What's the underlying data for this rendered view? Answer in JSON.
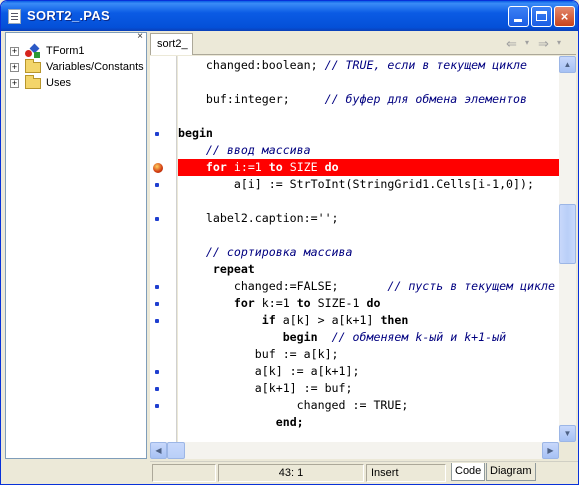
{
  "window": {
    "title": "SORT2_.PAS",
    "close_glyph": "×"
  },
  "tree": {
    "close_glyph": "×",
    "items": [
      {
        "label": "TForm1",
        "icon": "form-components-icon",
        "expander": "+"
      },
      {
        "label": "Variables/Constants",
        "icon": "folder-icon",
        "expander": "+"
      },
      {
        "label": "Uses",
        "icon": "folder-icon",
        "expander": "+"
      }
    ]
  },
  "editor": {
    "tab_label": "sort2_",
    "nav_back": "⇐",
    "nav_forward": "⇒",
    "nav_dropdown": "▾",
    "lines": [
      {
        "segments": [
          {
            "t": "    changed:boolean; "
          },
          {
            "t": "// TRUE, если в текущем цикле",
            "c": "cm"
          }
        ],
        "marker": ""
      },
      {
        "segments": [
          {
            "t": ""
          }
        ],
        "marker": ""
      },
      {
        "segments": [
          {
            "t": "    buf:integer;     "
          },
          {
            "t": "// буфер для обмена элементов",
            "c": "cm"
          }
        ],
        "marker": ""
      },
      {
        "segments": [
          {
            "t": ""
          }
        ],
        "marker": ""
      },
      {
        "segments": [
          {
            "t": "begin",
            "c": "kw"
          }
        ],
        "marker": "dot"
      },
      {
        "segments": [
          {
            "t": "    "
          },
          {
            "t": "// ввод массива",
            "c": "cm"
          }
        ],
        "marker": ""
      },
      {
        "segments": [
          {
            "t": "    "
          },
          {
            "t": "for",
            "c": "kw"
          },
          {
            "t": " i:=1 "
          },
          {
            "t": "to",
            "c": "kw"
          },
          {
            "t": " SIZE "
          },
          {
            "t": "do",
            "c": "kw"
          }
        ],
        "marker": "breakpoint",
        "highlight": true
      },
      {
        "segments": [
          {
            "t": "        a[i] := StrToInt(StringGrid1.Cells[i-1,0]);"
          }
        ],
        "marker": "dot"
      },
      {
        "segments": [
          {
            "t": ""
          }
        ],
        "marker": ""
      },
      {
        "segments": [
          {
            "t": "    label2.caption:='';"
          }
        ],
        "marker": "dot"
      },
      {
        "segments": [
          {
            "t": ""
          }
        ],
        "marker": ""
      },
      {
        "segments": [
          {
            "t": "    "
          },
          {
            "t": "// сортировка массива",
            "c": "cm"
          }
        ],
        "marker": ""
      },
      {
        "segments": [
          {
            "t": "     "
          },
          {
            "t": "repeat",
            "c": "kw"
          }
        ],
        "marker": ""
      },
      {
        "segments": [
          {
            "t": "        changed:=FALSE;       "
          },
          {
            "t": "// пусть в текущем цикле",
            "c": "cm"
          }
        ],
        "marker": "dot"
      },
      {
        "segments": [
          {
            "t": "        "
          },
          {
            "t": "for",
            "c": "kw"
          },
          {
            "t": " k:=1 "
          },
          {
            "t": "to",
            "c": "kw"
          },
          {
            "t": " SIZE-1 "
          },
          {
            "t": "do",
            "c": "kw"
          }
        ],
        "marker": "dot"
      },
      {
        "segments": [
          {
            "t": "            "
          },
          {
            "t": "if",
            "c": "kw"
          },
          {
            "t": " a[k] > a[k+1] "
          },
          {
            "t": "then",
            "c": "kw"
          }
        ],
        "marker": "dot"
      },
      {
        "segments": [
          {
            "t": "               "
          },
          {
            "t": "begin",
            "c": "kw"
          },
          {
            "t": "  "
          },
          {
            "t": "// обменяем k-ый и k+1-ый",
            "c": "cm"
          }
        ],
        "marker": ""
      },
      {
        "segments": [
          {
            "t": "           buf := a[k];"
          }
        ],
        "marker": ""
      },
      {
        "segments": [
          {
            "t": "           a[k] := a[k+1];"
          }
        ],
        "marker": "dot"
      },
      {
        "segments": [
          {
            "t": "           a[k+1] := buf;"
          }
        ],
        "marker": "dot"
      },
      {
        "segments": [
          {
            "t": "                 changed := TRUE;"
          }
        ],
        "marker": "dot"
      },
      {
        "segments": [
          {
            "t": "              "
          },
          {
            "t": "end;",
            "c": "kw"
          }
        ],
        "marker": ""
      }
    ]
  },
  "scroll": {
    "up": "▲",
    "down": "▼",
    "left": "◀",
    "right": "▶",
    "vertical_position": 0.45,
    "horizontal_position": 0.0
  },
  "status": {
    "position": "43:  1",
    "mode": "Insert",
    "tab_code": "Code",
    "tab_diagram": "Diagram"
  },
  "colors": {
    "title_bar": "#0b5be4",
    "execution_line": "#ff0000",
    "comment": "#000080",
    "breakpoint_dot": "#1f3fd0"
  }
}
